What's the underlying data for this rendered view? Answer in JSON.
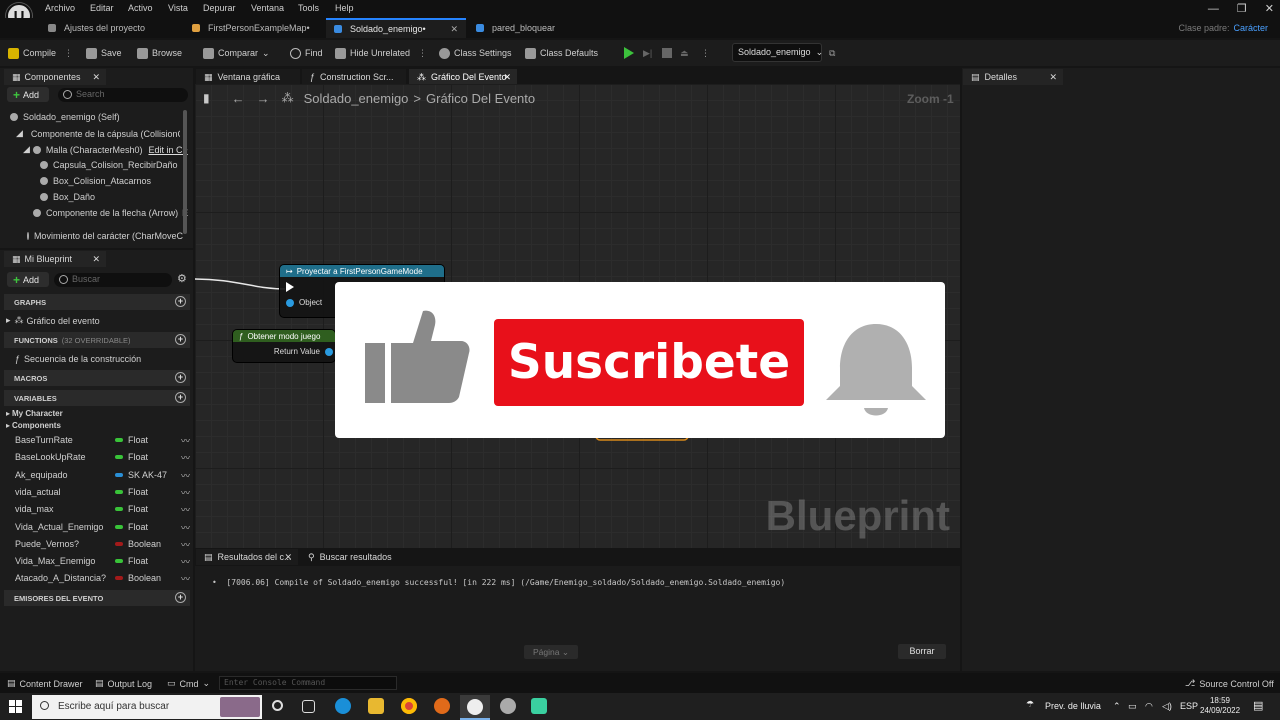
{
  "menu": {
    "items": [
      "Archivo",
      "Editar",
      "Activo",
      "Vista",
      "Depurar",
      "Ventana",
      "Tools",
      "Help"
    ]
  },
  "doc_tabs": [
    {
      "label": "Ajustes del proyecto"
    },
    {
      "label": "FirstPersonExampleMap•"
    },
    {
      "label": "Soldado_enemigo•"
    },
    {
      "label": "pared_bloquear"
    }
  ],
  "parent_class": {
    "label": "Clase padre:",
    "value": "Carácter"
  },
  "toolbar": {
    "compile": "Compile",
    "save": "Save",
    "browse": "Browse",
    "compare": "Comparar",
    "find": "Find",
    "hide_unrelated": "Hide Unrelated",
    "class_settings": "Class Settings",
    "class_defaults": "Class Defaults",
    "debug_object": "Soldado_enemigo"
  },
  "components": {
    "tab": "Componentes",
    "add": "Add",
    "search_placeholder": "Search",
    "items": [
      "Soldado_enemigo (Self)",
      "Componente de la cápsula (CollisionC",
      "Malla (CharacterMesh0)",
      "Capsula_Colision_RecibirDaño",
      "Box_Colision_Atacarnos",
      "Box_Daño",
      "Componente de la flecha (Arrow)",
      "Movimiento del carácter (CharMoveC"
    ],
    "edit_in_cpp": "Edit in C+",
    "arrow_suffix": "E"
  },
  "my_blueprint": {
    "tab": "Mi Blueprint",
    "add": "Add",
    "search_placeholder": "Buscar",
    "graphs_header": "GRAPHS",
    "graph_item": "Gráfico del evento",
    "functions_header": "FUNCTIONS",
    "functions_overridable": "(32 OVERRIDABLE)",
    "function_item": "Secuencia de la construcción",
    "macros_header": "MACROS",
    "variables_header": "VARIABLES",
    "categories": [
      "My Character",
      "Components"
    ],
    "variables": [
      {
        "name": "BaseTurnRate",
        "type": "Float",
        "color": "#39c339"
      },
      {
        "name": "BaseLookUpRate",
        "type": "Float",
        "color": "#39c339"
      },
      {
        "name": "Ak_equipado",
        "type": "SK AK-47",
        "color": "#2a8fd6"
      },
      {
        "name": "vida_actual",
        "type": "Float",
        "color": "#39c339"
      },
      {
        "name": "vida_max",
        "type": "Float",
        "color": "#39c339"
      },
      {
        "name": "Vida_Actual_Enemigo",
        "type": "Float",
        "color": "#39c339"
      },
      {
        "name": "Puede_Vernos?",
        "type": "Boolean",
        "color": "#a31a1a"
      },
      {
        "name": "Vida_Max_Enemigo",
        "type": "Float",
        "color": "#39c339"
      },
      {
        "name": "Atacado_A_Distancia?",
        "type": "Boolean",
        "color": "#a31a1a"
      }
    ],
    "dispatchers_header": "EMISORES DEL EVENTO"
  },
  "editor_tabs": [
    "Ventana gráfica",
    "Construction Scr...",
    "Gráfico Del Evento"
  ],
  "graph": {
    "breadcrumb_root": "Soldado_enemigo",
    "breadcrumb_sep": ">",
    "breadcrumb_leaf": "Gráfico Del Evento",
    "zoom": "Zoom -1",
    "watermark": "Blueprint",
    "cast_node": {
      "title": "Proyectar a FirstPersonGameMode",
      "pin": "Object"
    },
    "get_node": {
      "title": "Obtener modo juego",
      "pin": "Return Value"
    }
  },
  "overlay": {
    "button": "Suscribete"
  },
  "details": {
    "tab": "Detalles"
  },
  "results": {
    "tab_results": "Resultados del c...",
    "tab_search": "Buscar resultados",
    "log": "[7006.06] Compile of Soldado_enemigo successful! [in 222 ms] (/Game/Enemigo_soldado/Soldado_enemigo.Soldado_enemigo)",
    "page": "Página",
    "clear": "Borrar"
  },
  "statusbar": {
    "content_drawer": "Content Drawer",
    "output_log": "Output Log",
    "cmd": "Cmd",
    "console_placeholder": "Enter Console Command",
    "source_control": "Source Control Off"
  },
  "taskbar": {
    "search": "Escribe aquí para buscar",
    "weather": "Prev. de lluvia",
    "lang": "ESP",
    "time": "18:59",
    "date": "24/09/2022"
  }
}
